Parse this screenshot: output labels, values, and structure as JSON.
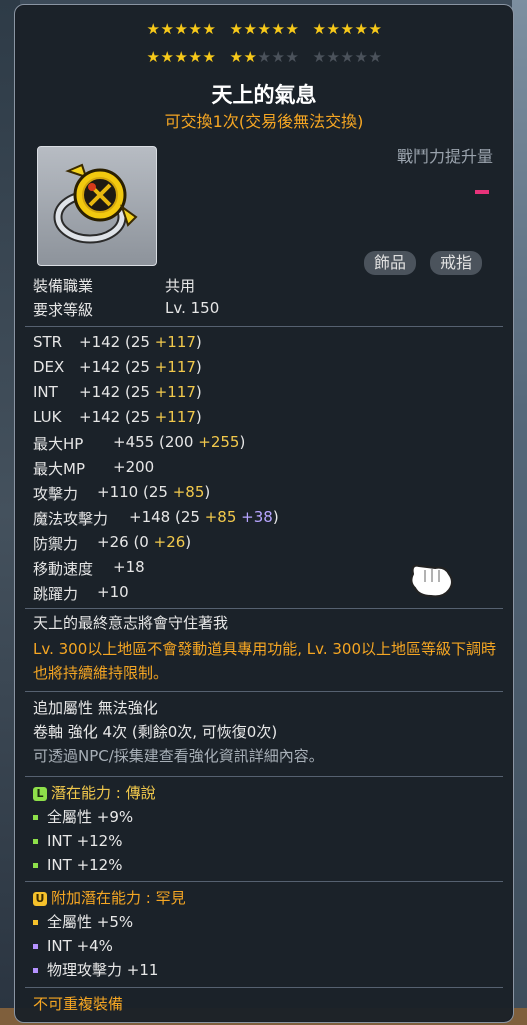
{
  "item": {
    "stars": {
      "rows": [
        [
          5,
          5,
          5
        ],
        [
          5,
          5,
          5
        ]
      ],
      "filled": 22
    },
    "name": "天上的氣息",
    "trade_note": "可交換1次(交易後無法交換)",
    "combat_power_label": "戰鬥力提升量",
    "tags": [
      "飾品",
      "戒指"
    ],
    "icon": "golden-shield-ring-icon",
    "requirements": [
      {
        "label": "裝備職業",
        "value": "共用"
      },
      {
        "label": "要求等級",
        "value": "Lv. 150"
      }
    ],
    "stats": [
      {
        "label": "STR",
        "total": "+142",
        "base": "(25",
        "bonus": "+117",
        "extra": "",
        "close": ")"
      },
      {
        "label": "DEX",
        "total": "+142",
        "base": "(25",
        "bonus": "+117",
        "extra": "",
        "close": ")"
      },
      {
        "label": "INT",
        "total": "+142",
        "base": "(25",
        "bonus": "+117",
        "extra": "",
        "close": ")"
      },
      {
        "label": "LUK",
        "total": "+142",
        "base": "(25",
        "bonus": "+117",
        "extra": "",
        "close": ")"
      },
      {
        "label": "最大HP",
        "total": "+455",
        "base": "(200",
        "bonus": "+255",
        "extra": "",
        "close": ")"
      },
      {
        "label": "最大MP",
        "total": "+200",
        "base": "",
        "bonus": "",
        "extra": "",
        "close": ""
      },
      {
        "label": "攻擊力",
        "total": "+110",
        "base": "(25",
        "bonus": "+85",
        "extra": "",
        "close": ")"
      },
      {
        "label": "魔法攻擊力",
        "total": "+148",
        "base": "(25",
        "bonus": "+85",
        "extra": "+38",
        "close": ")"
      },
      {
        "label": "防禦力",
        "total": "+26",
        "base": "(0",
        "bonus": "+26",
        "extra": "",
        "close": ")"
      },
      {
        "label": "移動速度",
        "total": "+18",
        "base": "",
        "bonus": "",
        "extra": "",
        "close": ""
      },
      {
        "label": "跳躍力",
        "total": "+10",
        "base": "",
        "bonus": "",
        "extra": "",
        "close": ""
      }
    ],
    "flavor": "天上的最終意志將會守住著我",
    "region_note": "Lv. 300以上地區不會發動道具專用功能, Lv. 300以上地區等級下調時也將持續維持限制。",
    "extra_attr": "追加屬性 無法強化",
    "scroll": "卷軸 強化 4次 (剩餘0次, 可恢復0次)",
    "npc_note": "可透過NPC/採集建查看強化資訊詳細內容。",
    "potential": {
      "title": "潛在能力 : 傳說",
      "badge": "L",
      "lines": [
        "全屬性 +9%",
        "INT +12%",
        "INT +12%"
      ]
    },
    "additional_potential": {
      "title": "附加潛在能力 : 罕見",
      "badge": "U",
      "lines": [
        "全屬性 +5%",
        "INT +4%",
        "物理攻擊力 +11"
      ]
    },
    "footer": "不可重複裝備"
  }
}
